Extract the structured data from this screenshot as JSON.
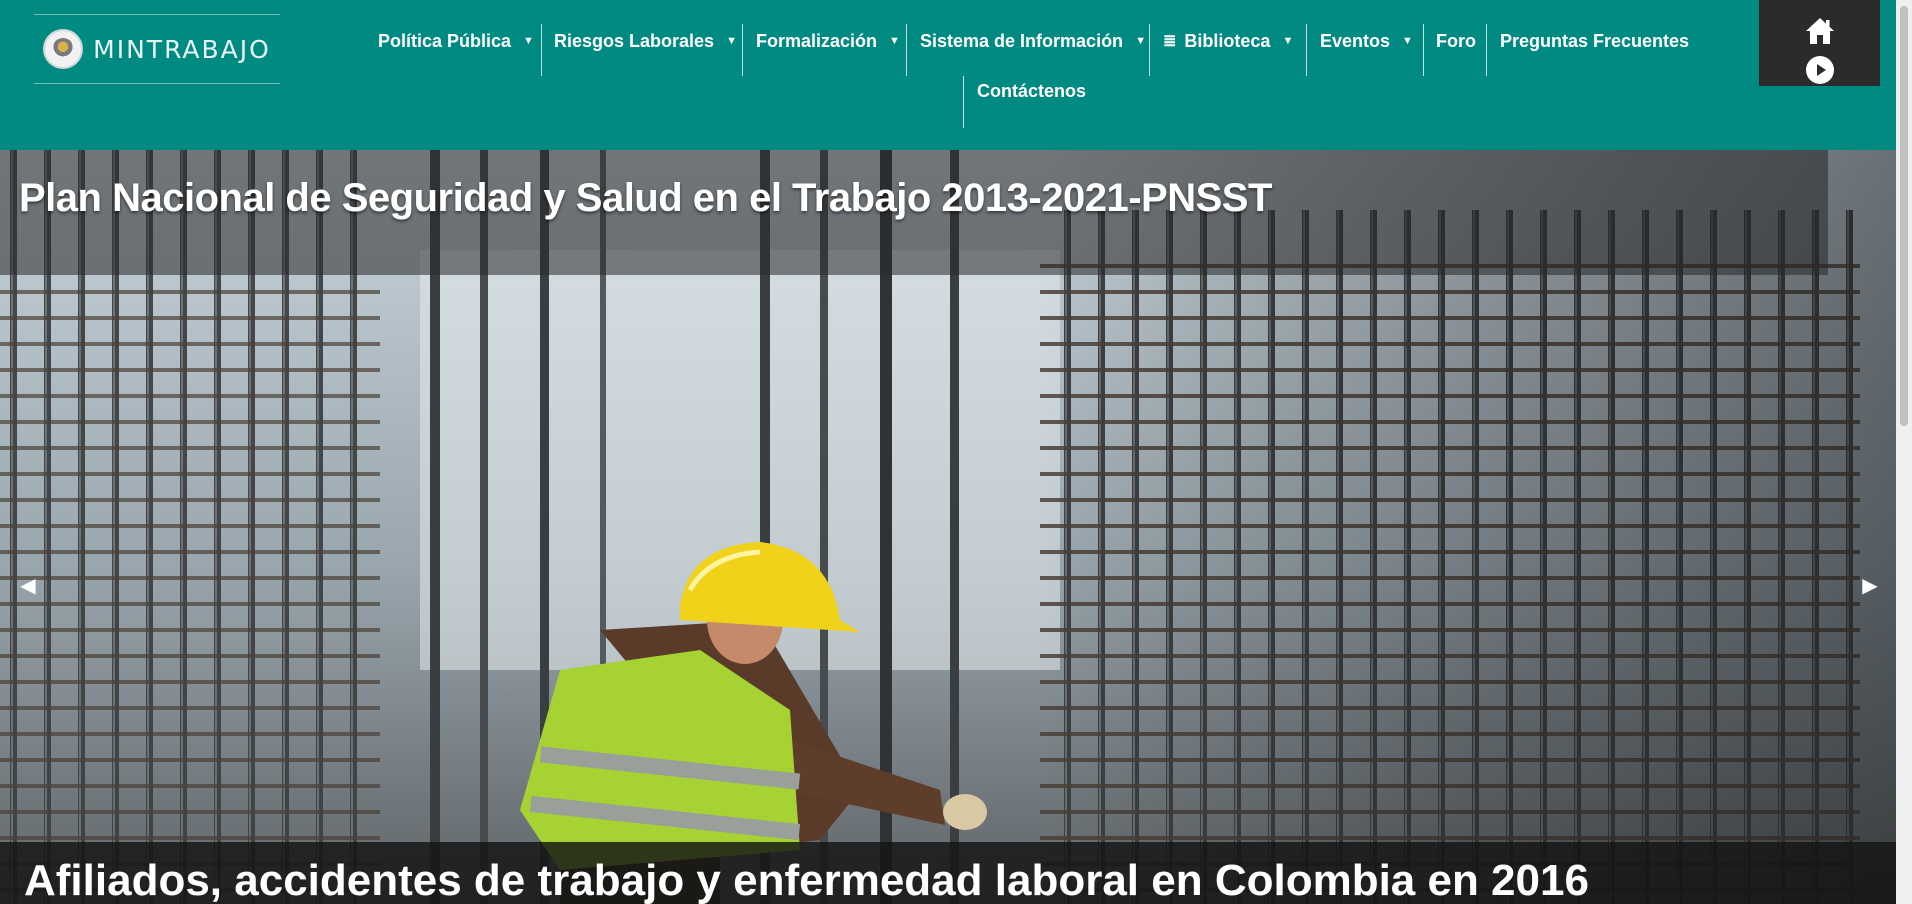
{
  "brand": {
    "logo_text": "MINTRABAJO"
  },
  "nav": {
    "items": [
      {
        "label": "Política Pública"
      },
      {
        "label": "Riesgos Laborales"
      },
      {
        "label": "Formalización"
      },
      {
        "label": "Sistema de Información"
      },
      {
        "label": "Biblioteca"
      },
      {
        "label": "Eventos"
      },
      {
        "label": "Foro"
      },
      {
        "label": "Preguntas Frecuentes"
      },
      {
        "label": "Contáctenos"
      }
    ],
    "caret_glyph": "▼",
    "list_glyph": "≣"
  },
  "slider": {
    "title": "Plan Nacional de Seguridad y Salud en el Trabajo 2013-2021-PNSST",
    "prev_glyph": "◀",
    "next_glyph": "▶",
    "next_slide_title": "Afiliados, accidentes de trabajo y enfermedad laboral en Colombia en 2016"
  },
  "colors": {
    "header_bg": "#008a82",
    "home_box_bg": "#2b2b2b",
    "text": "#ffffff"
  },
  "icons": [
    "home-icon",
    "play-icon",
    "chevron-left-icon",
    "chevron-right-icon",
    "list-icon",
    "caret-down-icon"
  ]
}
